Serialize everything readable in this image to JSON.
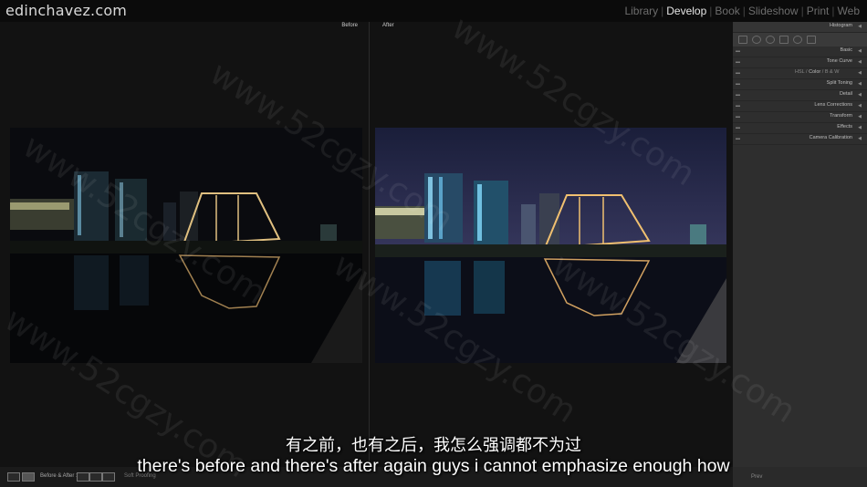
{
  "app": {
    "brand": "edinchavez.com",
    "modules": [
      "Library",
      "Develop",
      "Book",
      "Slideshow",
      "Print",
      "Web"
    ],
    "active_module": "Develop"
  },
  "view": {
    "before_label": "Before",
    "after_label": "After"
  },
  "right_panel": {
    "histogram": "Histogram",
    "sections": [
      "Basic",
      "Tone Curve",
      "Split Toning",
      "Detail",
      "Lens Corrections",
      "Transform",
      "Effects",
      "Camera Calibration"
    ],
    "color_row": {
      "hsl": "HSL",
      "color": "Color",
      "bw": "B & W"
    }
  },
  "bottom_bar": {
    "mode": "Before & After :",
    "soft_proofing": "Soft Proofing",
    "prev": "Prev"
  },
  "subtitles": {
    "chinese": "有之前，也有之后，我怎么强调都不为过",
    "english": "there's before and there's after again guys i cannot emphasize enough how"
  },
  "watermark": "www.52cgzy.com",
  "colors": {
    "accent": "#e6e6e6",
    "panel": "#2e2e2e",
    "background": "#121212"
  }
}
